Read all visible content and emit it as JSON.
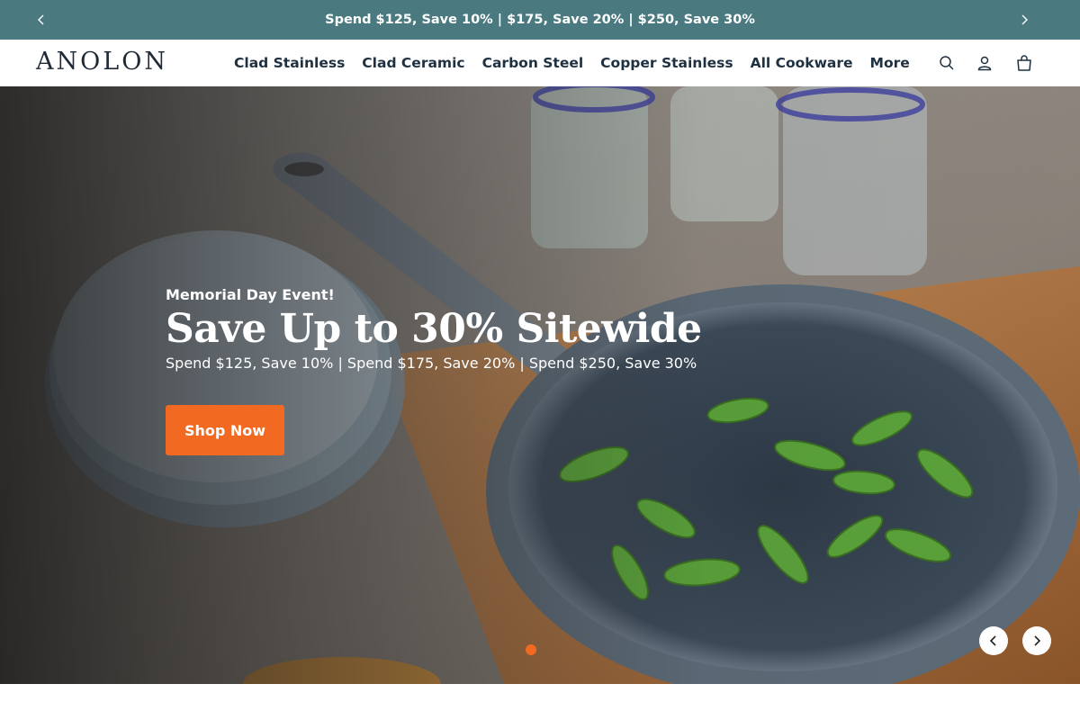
{
  "announcement": {
    "text": "Spend $125, Save 10% | $175, Save 20% | $250, Save 30%",
    "prev_icon": "chevron-left-icon",
    "next_icon": "chevron-right-icon"
  },
  "header": {
    "logo_text": "ANOLON",
    "nav": [
      {
        "label": "Clad Stainless"
      },
      {
        "label": "Clad Ceramic"
      },
      {
        "label": "Carbon Steel"
      },
      {
        "label": "Copper Stainless"
      },
      {
        "label": "All Cookware"
      },
      {
        "label": "More"
      }
    ],
    "icons": [
      "search-icon",
      "account-icon",
      "cart-icon"
    ]
  },
  "hero": {
    "eyebrow": "Memorial Day Event!",
    "title": "Save Up to 30% Sitewide",
    "subtitle": "Spend $125, Save 10% | Spend $175, Save 20% | Spend $250, Save 30%",
    "cta_label": "Shop Now",
    "slide_count_visible": 1,
    "active_slide": 1
  },
  "colors": {
    "announcement_bg": "#4a7a80",
    "cta": "#f26a21",
    "nav_text": "#1f3140",
    "active_dot": "#f26a21"
  }
}
